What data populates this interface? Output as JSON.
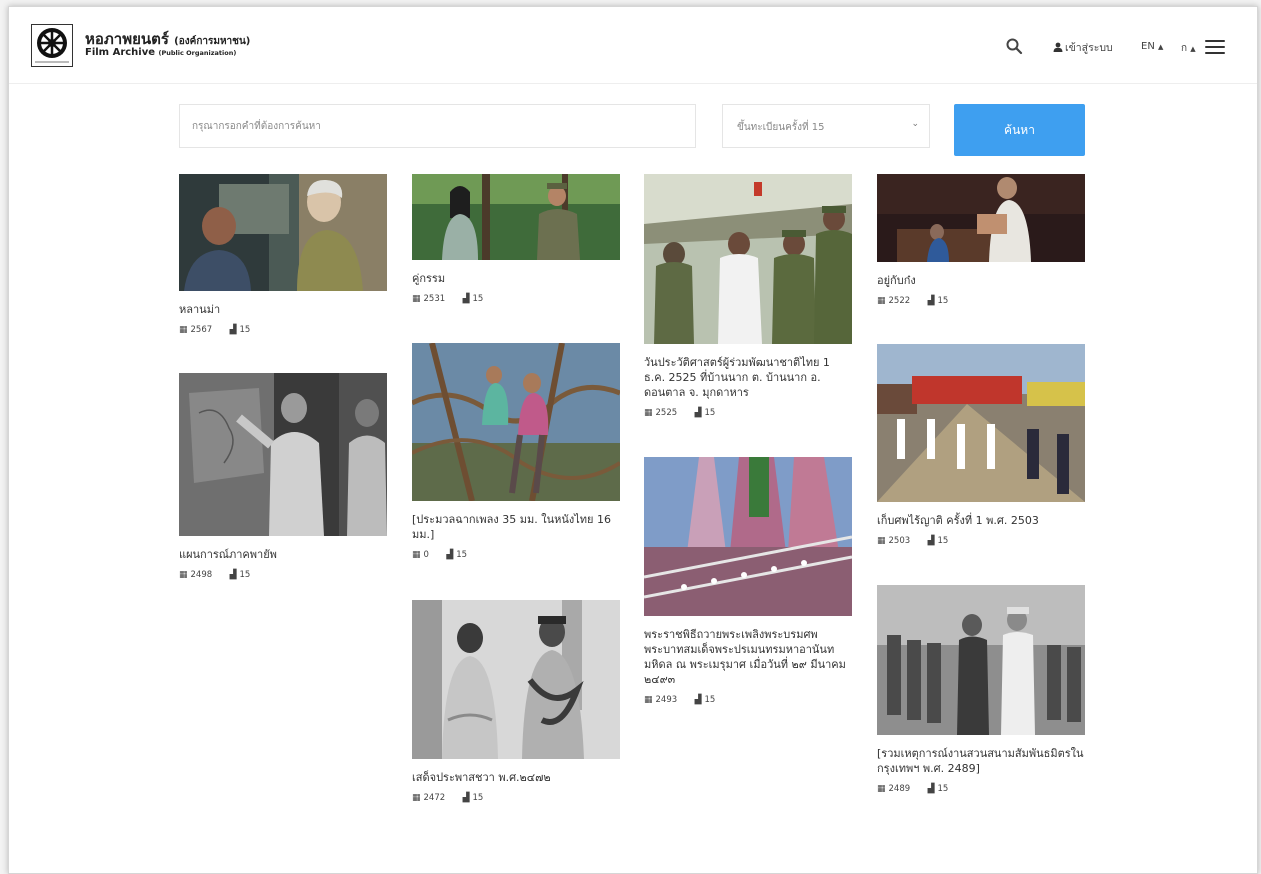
{
  "header": {
    "brand_th": "หอภาพยนตร์",
    "brand_th_sub": "(องค์การมหาชน)",
    "brand_en": "Film Archive",
    "brand_en_sub": "(Public Organization)",
    "login_label": "เข้าสู่ระบบ",
    "lang_label": "EN",
    "font_size_label": "ก",
    "icons": [
      "search-icon",
      "user-icon",
      "menu-icon"
    ]
  },
  "search": {
    "placeholder": "กรุณากรอกคำที่ต้องการค้นหา",
    "filter_value": "ขึ้นทะเบียนครั้งที่ 15",
    "button_label": "ค้นหา"
  },
  "accent_color": "#3e9ff0",
  "cards": [
    {
      "title": "หลานม่า",
      "year": "2567",
      "round": "15"
    },
    {
      "title": "แผนการณ์ภาคพายัพ",
      "year": "2498",
      "round": "15"
    },
    {
      "title": "คู่กรรม",
      "year": "2531",
      "round": "15"
    },
    {
      "title": "[ประมวลฉากเพลง 35 มม. ในหนังไทย 16 มม.]",
      "year": "0",
      "round": "15"
    },
    {
      "title": "เสด็จประพาสชวา พ.ศ.๒๔๗๒",
      "year": "2472",
      "round": "15"
    },
    {
      "title": "วันประวัติศาสตร์ผู้ร่วมพัฒนาชาติไทย 1 ธ.ค. 2525 ที่บ้านนาก ต. บ้านนาก อ. ดอนตาล จ. มุกดาหาร",
      "year": "2525",
      "round": "15"
    },
    {
      "title": "พระราชพิธีถวายพระเพลิงพระบรมศพ พระบาทสมเด็จพระปรเมนทรมหาอานันท มหิดล ณ พระเมรุมาศ เมื่อวันที่ ๒๙ มีนาคม ๒๔๙๓",
      "year": "2493",
      "round": "15"
    },
    {
      "title": "อยู่กับก๋ง",
      "year": "2522",
      "round": "15"
    },
    {
      "title": "เก็บศพไร้ญาติ ครั้งที่ 1 พ.ศ. 2503",
      "year": "2503",
      "round": "15"
    },
    {
      "title": "[รวมเหตุการณ์งานสวนสนามสัมพันธมิตรในกรุงเทพฯ พ.ศ. 2489]",
      "year": "2489",
      "round": "15"
    }
  ]
}
